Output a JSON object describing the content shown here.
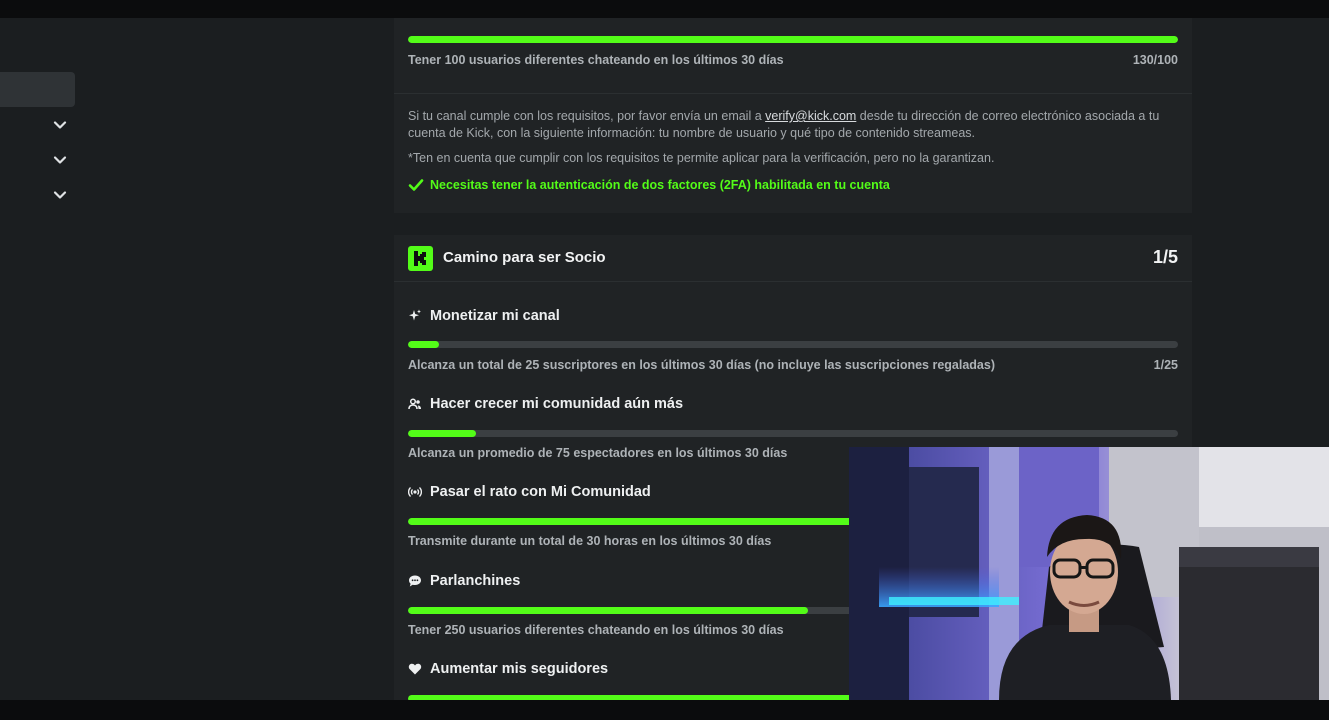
{
  "progress_top": {
    "requirement": "Tener 100 usuarios diferentes chateando en los últimos 30 días",
    "count": "130/100",
    "fraction": 1.0
  },
  "verification": {
    "info_prefix": "Si tu canal cumple con los requisitos, por favor envía un email a ",
    "email": "verify@kick.com",
    "info_suffix": " desde tu dirección de correo electrónico asociada a tu cuenta de Kick, con la siguiente información: tu nombre de usuario y qué tipo de contenido streameas.",
    "note": "*Ten en cuenta que cumplir con los requisitos te permite aplicar para la verificación, pero no la garantizan.",
    "check": "Necesitas tener la autenticación de dos factores (2FA) habilitada en tu cuenta"
  },
  "partner": {
    "title": "Camino para ser Socio",
    "count": "1/5",
    "sections": [
      {
        "title": "Monetizar mi canal",
        "icon": "sparkle-icon",
        "requirement": "Alcanza un total de 25 suscriptores en los últimos 30 días (no incluye las suscripciones regaladas)",
        "count": "1/25",
        "fraction": 0.04
      },
      {
        "title": "Hacer crecer mi comunidad aún más",
        "icon": "users-icon",
        "requirement": "Alcanza un promedio de 75 espectadores en los últimos 30 días",
        "count": "",
        "fraction": 0.088
      },
      {
        "title": "Pasar el rato con Mi Comunidad",
        "icon": "broadcast-icon",
        "requirement": "Transmite durante un total de 30 horas en los últimos 30 días",
        "count": "",
        "fraction": 1.0
      },
      {
        "title": "Parlanchines",
        "icon": "chat-bubble-icon",
        "requirement": "Tener 250 usuarios diferentes chateando en los últimos 30 días",
        "count": "",
        "fraction": 0.52
      },
      {
        "title": "Aumentar mis seguidores",
        "icon": "heart-icon",
        "requirement": "",
        "count": "",
        "fraction": 1.0
      }
    ]
  },
  "colors": {
    "accent": "#53fc18",
    "card": "#202325",
    "track": "#3b3f42"
  }
}
